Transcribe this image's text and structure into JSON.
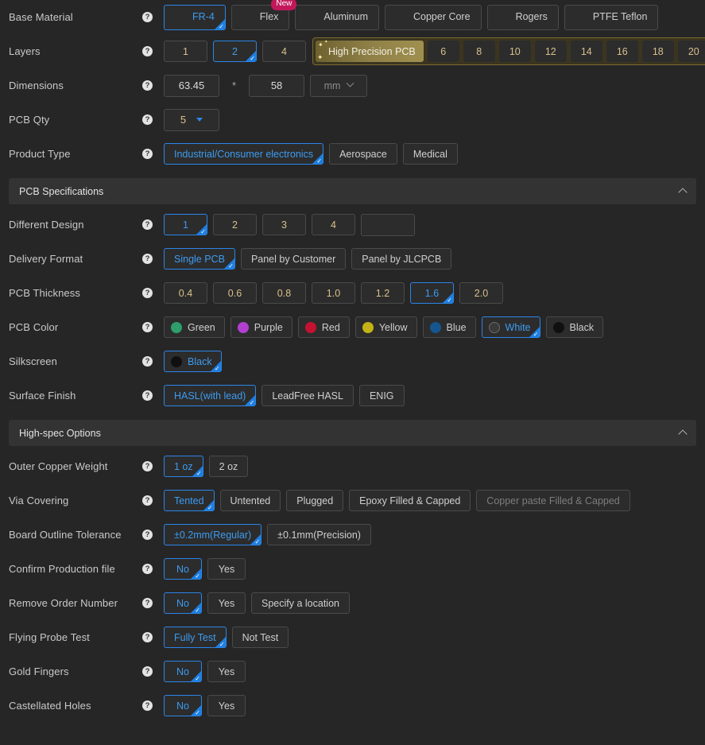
{
  "rows": {
    "base_material": {
      "label": "Base Material",
      "options": [
        {
          "label": "FR-4",
          "icon": "fr4-diamond-icon",
          "selected": true
        },
        {
          "label": "Flex",
          "icon": "flex-blob-icon",
          "selected": false,
          "badge": "New"
        },
        {
          "label": "Aluminum",
          "icon": "aluminum-circle-icon",
          "selected": false
        },
        {
          "label": "Copper Core",
          "icon": "copper-core-circle-icon",
          "selected": false
        },
        {
          "label": "Rogers",
          "icon": "rogers-diamond-icon",
          "selected": false
        },
        {
          "label": "PTFE Teflon",
          "icon": "ptfe-diamond-icon",
          "selected": false
        }
      ]
    },
    "layers": {
      "label": "Layers",
      "options": [
        {
          "label": "1",
          "selected": false
        },
        {
          "label": "2",
          "selected": true
        },
        {
          "label": "4",
          "selected": false
        }
      ],
      "high_precision": {
        "label": "High Precision PCB",
        "options": [
          "6",
          "8",
          "10",
          "12",
          "14",
          "16",
          "18",
          "20"
        ]
      }
    },
    "dimensions": {
      "label": "Dimensions",
      "width_value": "63.45",
      "height_value": "58",
      "separator": "*",
      "unit": "mm"
    },
    "pcb_qty": {
      "label": "PCB Qty",
      "value": "5"
    },
    "product_type": {
      "label": "Product Type",
      "options": [
        {
          "label": "Industrial/Consumer electronics",
          "selected": true
        },
        {
          "label": "Aerospace",
          "selected": false
        },
        {
          "label": "Medical",
          "selected": false
        }
      ]
    },
    "different_design": {
      "label": "Different Design",
      "options": [
        {
          "label": "1",
          "selected": true
        },
        {
          "label": "2",
          "selected": false
        },
        {
          "label": "3",
          "selected": false
        },
        {
          "label": "4",
          "selected": false
        }
      ],
      "custom_value": ""
    },
    "delivery_format": {
      "label": "Delivery Format",
      "options": [
        {
          "label": "Single PCB",
          "selected": true
        },
        {
          "label": "Panel by Customer",
          "selected": false
        },
        {
          "label": "Panel by JLCPCB",
          "selected": false
        }
      ]
    },
    "pcb_thickness": {
      "label": "PCB Thickness",
      "options": [
        {
          "label": "0.4",
          "selected": false
        },
        {
          "label": "0.6",
          "selected": false
        },
        {
          "label": "0.8",
          "selected": false
        },
        {
          "label": "1.0",
          "selected": false
        },
        {
          "label": "1.2",
          "selected": false
        },
        {
          "label": "1.6",
          "selected": true
        },
        {
          "label": "2.0",
          "selected": false
        }
      ]
    },
    "pcb_color": {
      "label": "PCB Color",
      "options": [
        {
          "label": "Green",
          "color": "#2e9e6b",
          "selected": false
        },
        {
          "label": "Purple",
          "color": "#b23fd0",
          "selected": false
        },
        {
          "label": "Red",
          "color": "#c41230",
          "selected": false
        },
        {
          "label": "Yellow",
          "color": "#c4b315",
          "selected": false
        },
        {
          "label": "Blue",
          "color": "#16558f",
          "selected": false
        },
        {
          "label": "White",
          "color": "#3a3a3a",
          "selected": true
        },
        {
          "label": "Black",
          "color": "#101010",
          "selected": false
        }
      ]
    },
    "silkscreen": {
      "label": "Silkscreen",
      "options": [
        {
          "label": "Black",
          "color": "#101010",
          "selected": true
        }
      ]
    },
    "surface_finish": {
      "label": "Surface Finish",
      "options": [
        {
          "label": "HASL(with lead)",
          "selected": true
        },
        {
          "label": "LeadFree HASL",
          "selected": false
        },
        {
          "label": "ENIG",
          "selected": false
        }
      ]
    },
    "outer_copper_weight": {
      "label": "Outer Copper Weight",
      "options": [
        {
          "label": "1 oz",
          "selected": true
        },
        {
          "label": "2 oz",
          "selected": false
        }
      ]
    },
    "via_covering": {
      "label": "Via Covering",
      "options": [
        {
          "label": "Tented",
          "selected": true
        },
        {
          "label": "Untented",
          "selected": false
        },
        {
          "label": "Plugged",
          "selected": false
        },
        {
          "label": "Epoxy Filled & Capped",
          "selected": false
        },
        {
          "label": "Copper paste Filled & Capped",
          "selected": false,
          "disabled": true
        }
      ]
    },
    "board_outline_tolerance": {
      "label": "Board Outline Tolerance",
      "options": [
        {
          "label": "±0.2mm(Regular)",
          "selected": true
        },
        {
          "label": "±0.1mm(Precision)",
          "selected": false
        }
      ]
    },
    "confirm_production_file": {
      "label": "Confirm Production file",
      "options": [
        {
          "label": "No",
          "selected": true
        },
        {
          "label": "Yes",
          "selected": false
        }
      ]
    },
    "remove_order_number": {
      "label": "Remove Order Number",
      "options": [
        {
          "label": "No",
          "selected": true
        },
        {
          "label": "Yes",
          "selected": false
        },
        {
          "label": "Specify a location",
          "selected": false
        }
      ]
    },
    "flying_probe_test": {
      "label": "Flying Probe Test",
      "options": [
        {
          "label": "Fully Test",
          "selected": true
        },
        {
          "label": "Not Test",
          "selected": false
        }
      ]
    },
    "gold_fingers": {
      "label": "Gold Fingers",
      "options": [
        {
          "label": "No",
          "selected": true
        },
        {
          "label": "Yes",
          "selected": false
        }
      ]
    },
    "castellated_holes": {
      "label": "Castellated Holes",
      "options": [
        {
          "label": "No",
          "selected": true
        },
        {
          "label": "Yes",
          "selected": false
        }
      ]
    }
  },
  "sections": {
    "pcb_specifications": {
      "title": "PCB Specifications",
      "collapse_icon": "chevron-up-icon"
    },
    "high_spec_options": {
      "title": "High-spec Options",
      "collapse_icon": "chevron-up-icon"
    }
  },
  "help_icon": "?"
}
